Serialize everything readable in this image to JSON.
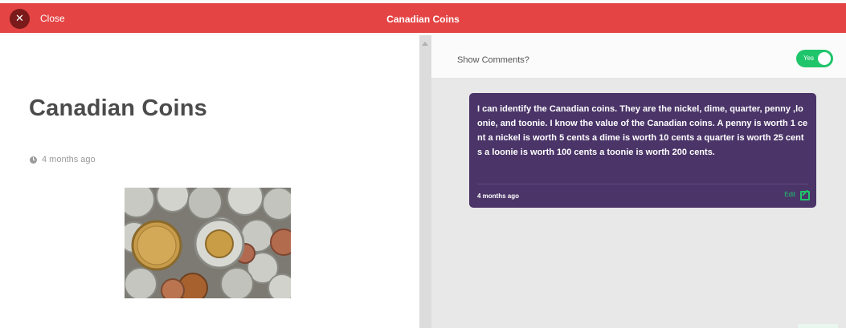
{
  "topbar": {
    "close_label": "Close",
    "title": "Canadian Coins",
    "color": "#e44444"
  },
  "post": {
    "title": "Canadian Coins",
    "timestamp": "4 months ago",
    "image_alt": "Pile of Canadian coins"
  },
  "comments": {
    "header_label": "Show Comments?",
    "toggle_label": "Yes",
    "toggle_on": true,
    "toggle_color": "#1fc56b",
    "card_color": "#4a3468",
    "items": [
      {
        "text": "I can identify the Canadian coins. They are the nickel, dime, quarter, penny ,loonie, and toonie. I know the value of the Canadian coins. A penny is worth 1 cent a nickel is worth 5 cents a dime is worth 10 cents a quarter is worth 25 cents a loonie is worth 100 cents a toonie is worth 200 cents.",
        "timestamp": "4 months ago",
        "edit_label": "Edit"
      }
    ]
  }
}
